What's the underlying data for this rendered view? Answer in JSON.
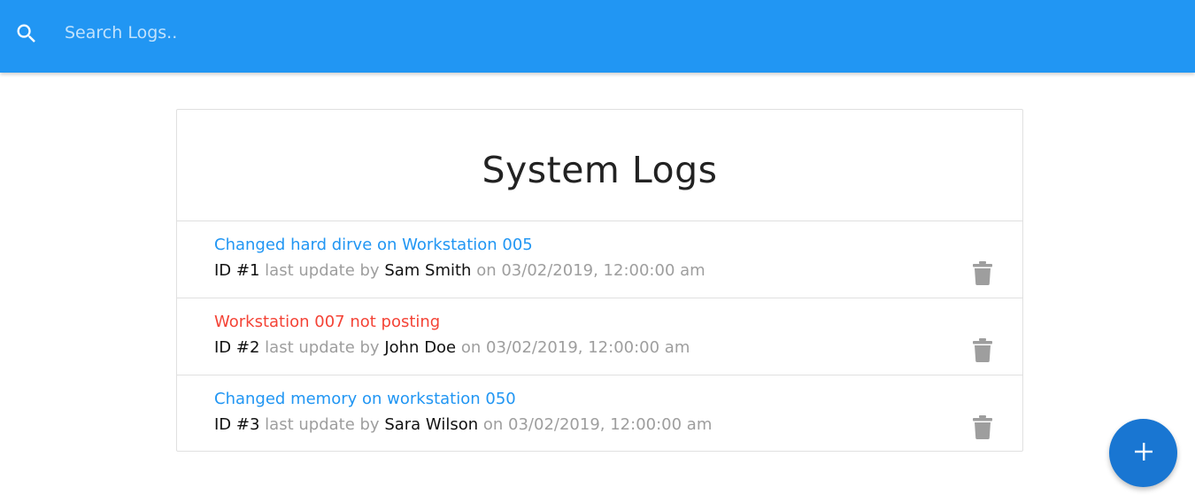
{
  "search": {
    "placeholder": "Search Logs..",
    "value": ""
  },
  "header": {
    "title": "System Logs"
  },
  "logs": [
    {
      "message": "Changed hard dirve on Workstation 005",
      "attention": false,
      "id_text": "ID #1",
      "last_update_by_label": "last update by",
      "tech": "Sam Smith",
      "on_label": "on",
      "date": "03/02/2019, 12:00:00 am"
    },
    {
      "message": "Workstation 007 not posting",
      "attention": true,
      "id_text": "ID #2",
      "last_update_by_label": "last update by",
      "tech": "John Doe",
      "on_label": "on",
      "date": "03/02/2019, 12:00:00 am"
    },
    {
      "message": "Changed memory on workstation 050",
      "attention": false,
      "id_text": "ID #3",
      "last_update_by_label": "last update by",
      "tech": "Sara Wilson",
      "on_label": "on",
      "date": "03/02/2019, 12:00:00 am"
    }
  ],
  "icons": {
    "search": "search-icon",
    "delete": "delete-icon",
    "add": "add-icon"
  },
  "colors": {
    "navbar": "#2196f3",
    "message_normal": "#2196f3",
    "message_attention": "#f44336",
    "meta_gray": "#9e9e9e",
    "fab": "#1976d2",
    "delete_icon": "#9e9e9e"
  }
}
